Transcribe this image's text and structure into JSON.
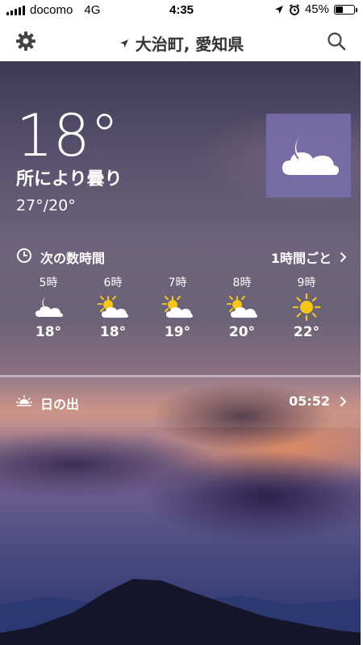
{
  "status_bar": {
    "carrier": "docomo",
    "network": "4G",
    "time": "4:35",
    "battery_percent": "45%",
    "battery_level": 0.45
  },
  "nav": {
    "location": "大治町, 愛知県"
  },
  "current": {
    "temperature": "18°",
    "condition": "所により曇り",
    "high_low": "27°/20°",
    "condition_icon": "moon-cloud-icon"
  },
  "hourly": {
    "title": "次の数時間",
    "interval_label": "1時間ごと",
    "items": [
      {
        "hour": "5時",
        "icon": "moon-cloud-icon",
        "temp": "18°"
      },
      {
        "hour": "6時",
        "icon": "sun-cloud-icon",
        "temp": "18°"
      },
      {
        "hour": "7時",
        "icon": "sun-cloud-icon",
        "temp": "19°"
      },
      {
        "hour": "8時",
        "icon": "sun-cloud-icon",
        "temp": "20°"
      },
      {
        "hour": "9時",
        "icon": "sun-icon",
        "temp": "22°"
      }
    ]
  },
  "sunrise": {
    "label": "日の出",
    "time": "05:52"
  },
  "colors": {
    "icon_box": "#7a6eae",
    "sun": "#f5c518"
  }
}
